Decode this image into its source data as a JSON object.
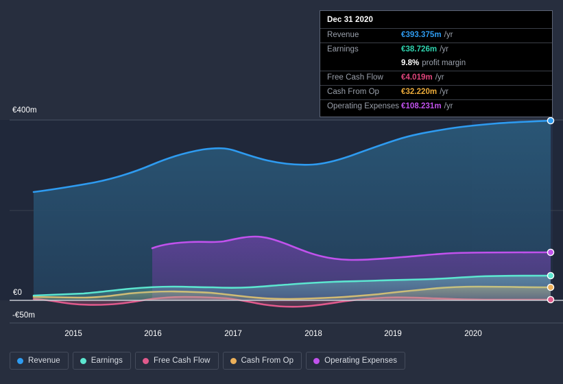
{
  "chart_data": {
    "type": "area",
    "title": "",
    "xlabel": "",
    "ylabel": "",
    "currency": "EUR",
    "units": "millions per year",
    "grid": true,
    "legend_position": "bottom",
    "xlim": [
      2014.5,
      2021.0
    ],
    "ylim": [
      -50,
      400
    ],
    "x_ticks": [
      "2015",
      "2016",
      "2017",
      "2018",
      "2019",
      "2020"
    ],
    "y_ticks": [
      "€400m",
      "€0",
      "-€50m"
    ],
    "y_tick_values": [
      400,
      0,
      -50
    ],
    "x": [
      2014.55,
      2015.0,
      2015.25,
      2015.5,
      2015.75,
      2016.0,
      2016.25,
      2016.5,
      2016.75,
      2017.0,
      2017.25,
      2017.5,
      2017.75,
      2018.0,
      2018.25,
      2018.5,
      2018.75,
      2019.0,
      2019.25,
      2019.5,
      2019.75,
      2020.0,
      2020.25,
      2020.5,
      2020.75,
      2021.0
    ],
    "series": [
      {
        "name": "Revenue",
        "color": "#2e9bf0",
        "fill": "#21415c",
        "values": [
          212,
          222,
          229,
          236,
          243,
          266,
          281,
          290,
          292,
          295,
          290,
          281,
          272,
          266,
          272,
          285,
          296,
          305,
          316,
          327,
          338,
          349,
          360,
          371,
          382,
          393.375
        ],
        "end_value": 393.375,
        "end_label": "€393.375m /yr"
      },
      {
        "name": "Earnings",
        "color": "#5ce6d0",
        "fill": "#2e5f63",
        "values": [
          10.5,
          11.0,
          11.5,
          12.5,
          13.5,
          14.5,
          16.0,
          17.5,
          18.5,
          19.0,
          19.0,
          19.0,
          19.5,
          20.5,
          23.0,
          25.5,
          27.5,
          28.5,
          29.0,
          29.5,
          31.0,
          33.5,
          36.5,
          38.0,
          38.5,
          38.726
        ],
        "end_value": 38.726,
        "end_label": "€38.726m /yr"
      },
      {
        "name": "Free Cash Flow",
        "color": "#e05a8c",
        "fill": "#5d3348",
        "values": [
          2.0,
          0.5,
          -3.0,
          -4.5,
          -5.0,
          -5.5,
          -5.0,
          -3.0,
          -0.5,
          1.5,
          2.5,
          3.0,
          3.0,
          2.5,
          1.5,
          -1.5,
          -4.5,
          -6.0,
          -6.0,
          -4.0,
          -1.0,
          2.0,
          4.5,
          5.5,
          4.8,
          4.019
        ],
        "end_value": 4.019,
        "end_label": "€4.019m /yr"
      },
      {
        "name": "Cash From Op",
        "color": "#ecb05a",
        "fill": "#6a5a43",
        "values": [
          6.5,
          6.5,
          6.0,
          6.0,
          5.5,
          5.0,
          7.0,
          9.5,
          11.0,
          11.5,
          11.5,
          11.0,
          10.5,
          10.0,
          9.0,
          7.0,
          5.0,
          4.0,
          4.0,
          6.0,
          10.0,
          16.0,
          24.0,
          31.0,
          32.5,
          32.22
        ],
        "end_value": 32.22,
        "end_label": "€32.220m /yr"
      },
      {
        "name": "Operating Expenses",
        "color": "#c152ed",
        "fill": "#4a3470",
        "start_x": 2016.0,
        "values": [
          null,
          null,
          null,
          null,
          null,
          118,
          124,
          125,
          125,
          130,
          134,
          132,
          126,
          118,
          110,
          104,
          103,
          103,
          104,
          106,
          108,
          108,
          108,
          108,
          108,
          108.231
        ],
        "end_value": 108.231,
        "end_label": "€108.231m /yr"
      }
    ]
  },
  "tooltip": {
    "title": "Dec 31 2020",
    "rows": [
      {
        "label": "Revenue",
        "value": "€393.375m",
        "unit": "/yr",
        "color": "#2e9bf0"
      },
      {
        "label": "Earnings",
        "value": "€38.726m",
        "unit": "/yr",
        "color": "#2fd3ae"
      },
      {
        "label": "Free Cash Flow",
        "value": "€4.019m",
        "unit": "/yr",
        "color": "#e0457c"
      },
      {
        "label": "Cash From Op",
        "value": "€32.220m",
        "unit": "/yr",
        "color": "#ecab3a"
      },
      {
        "label": "Operating Expenses",
        "value": "€108.231m",
        "unit": "/yr",
        "color": "#c152ed"
      }
    ],
    "margin_value": "9.8%",
    "margin_text": "profit margin"
  },
  "axis": {
    "y_top_label": "€400m",
    "y_zero_label": "€0",
    "y_bottom_label": "-€50m",
    "x_labels": [
      "2015",
      "2016",
      "2017",
      "2018",
      "2019",
      "2020"
    ]
  },
  "legend": {
    "items": [
      {
        "label": "Revenue",
        "color": "#2e9bf0"
      },
      {
        "label": "Earnings",
        "color": "#5ce6d0"
      },
      {
        "label": "Free Cash Flow",
        "color": "#e05a8c"
      },
      {
        "label": "Cash From Op",
        "color": "#ecb05a"
      },
      {
        "label": "Operating Expenses",
        "color": "#c152ed"
      }
    ]
  },
  "colors": {
    "background": "#272e3e",
    "plot_background": "#20283a",
    "gridline": "#3e4656",
    "zero_axis": "#c8ccd4",
    "tooltip_bg": "#000000",
    "tooltip_border": "#5d6476"
  }
}
